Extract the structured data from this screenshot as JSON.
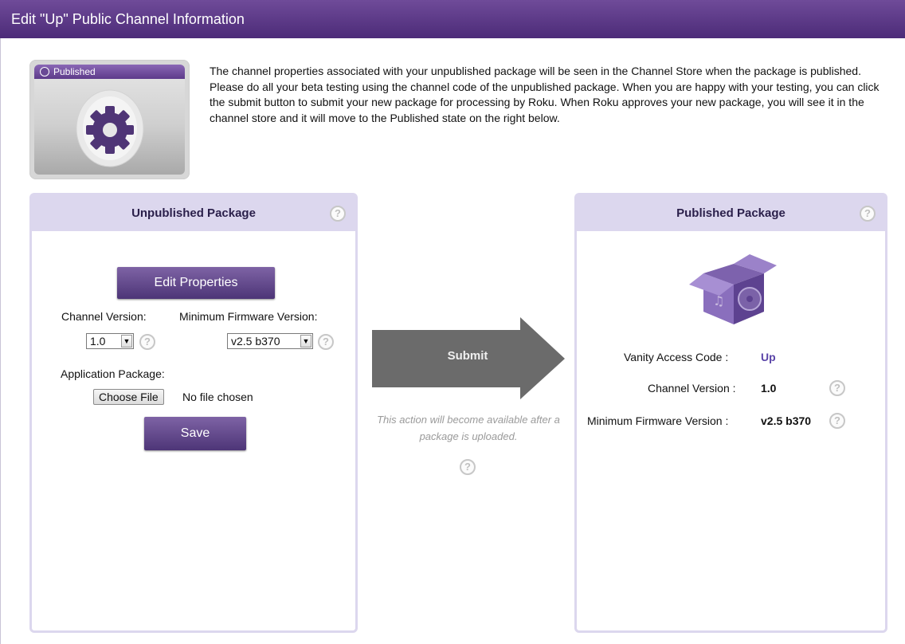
{
  "header": {
    "title": "Edit \"Up\" Public Channel Information"
  },
  "thumbnail": {
    "status_label": "Published",
    "icon": "gear-icon"
  },
  "intro_text": "The channel properties associated with your unpublished package will be seen in the Channel Store when the package is published. Please do all your beta testing using the channel code of the unpublished package. When you are happy with your testing, you can click the submit button to submit your new package for processing by Roku. When Roku approves your new package, you will see it in the channel store and it will move to the Published state on the right below.",
  "unpublished": {
    "title": "Unpublished Package",
    "help_icon": "?",
    "edit_button": "Edit Properties",
    "channel_version_label": "Channel Version:",
    "channel_version_value": "1.0",
    "min_firmware_label": "Minimum Firmware Version:",
    "min_firmware_value": "v2.5 b370",
    "app_package_label": "Application Package:",
    "choose_file_button": "Choose File",
    "file_status": "No file chosen",
    "save_button": "Save"
  },
  "submit": {
    "label": "Submit",
    "note": "This action will become available after a package is uploaded.",
    "help_icon": "?"
  },
  "published": {
    "title": "Published Package",
    "help_icon": "?",
    "icon": "box-icon",
    "vanity_label": "Vanity Access Code :",
    "vanity_value": "Up",
    "channel_version_label": "Channel Version :",
    "channel_version_value": "1.0",
    "min_firmware_label": "Minimum Firmware Version :",
    "min_firmware_value": "v2.5 b370"
  },
  "colors": {
    "header_purple": "#5a3787",
    "panel_header": "#dcd7ee",
    "button_purple": "#64498d",
    "arrow_gray": "#6b6b6b",
    "link_purple": "#5b45a8"
  }
}
